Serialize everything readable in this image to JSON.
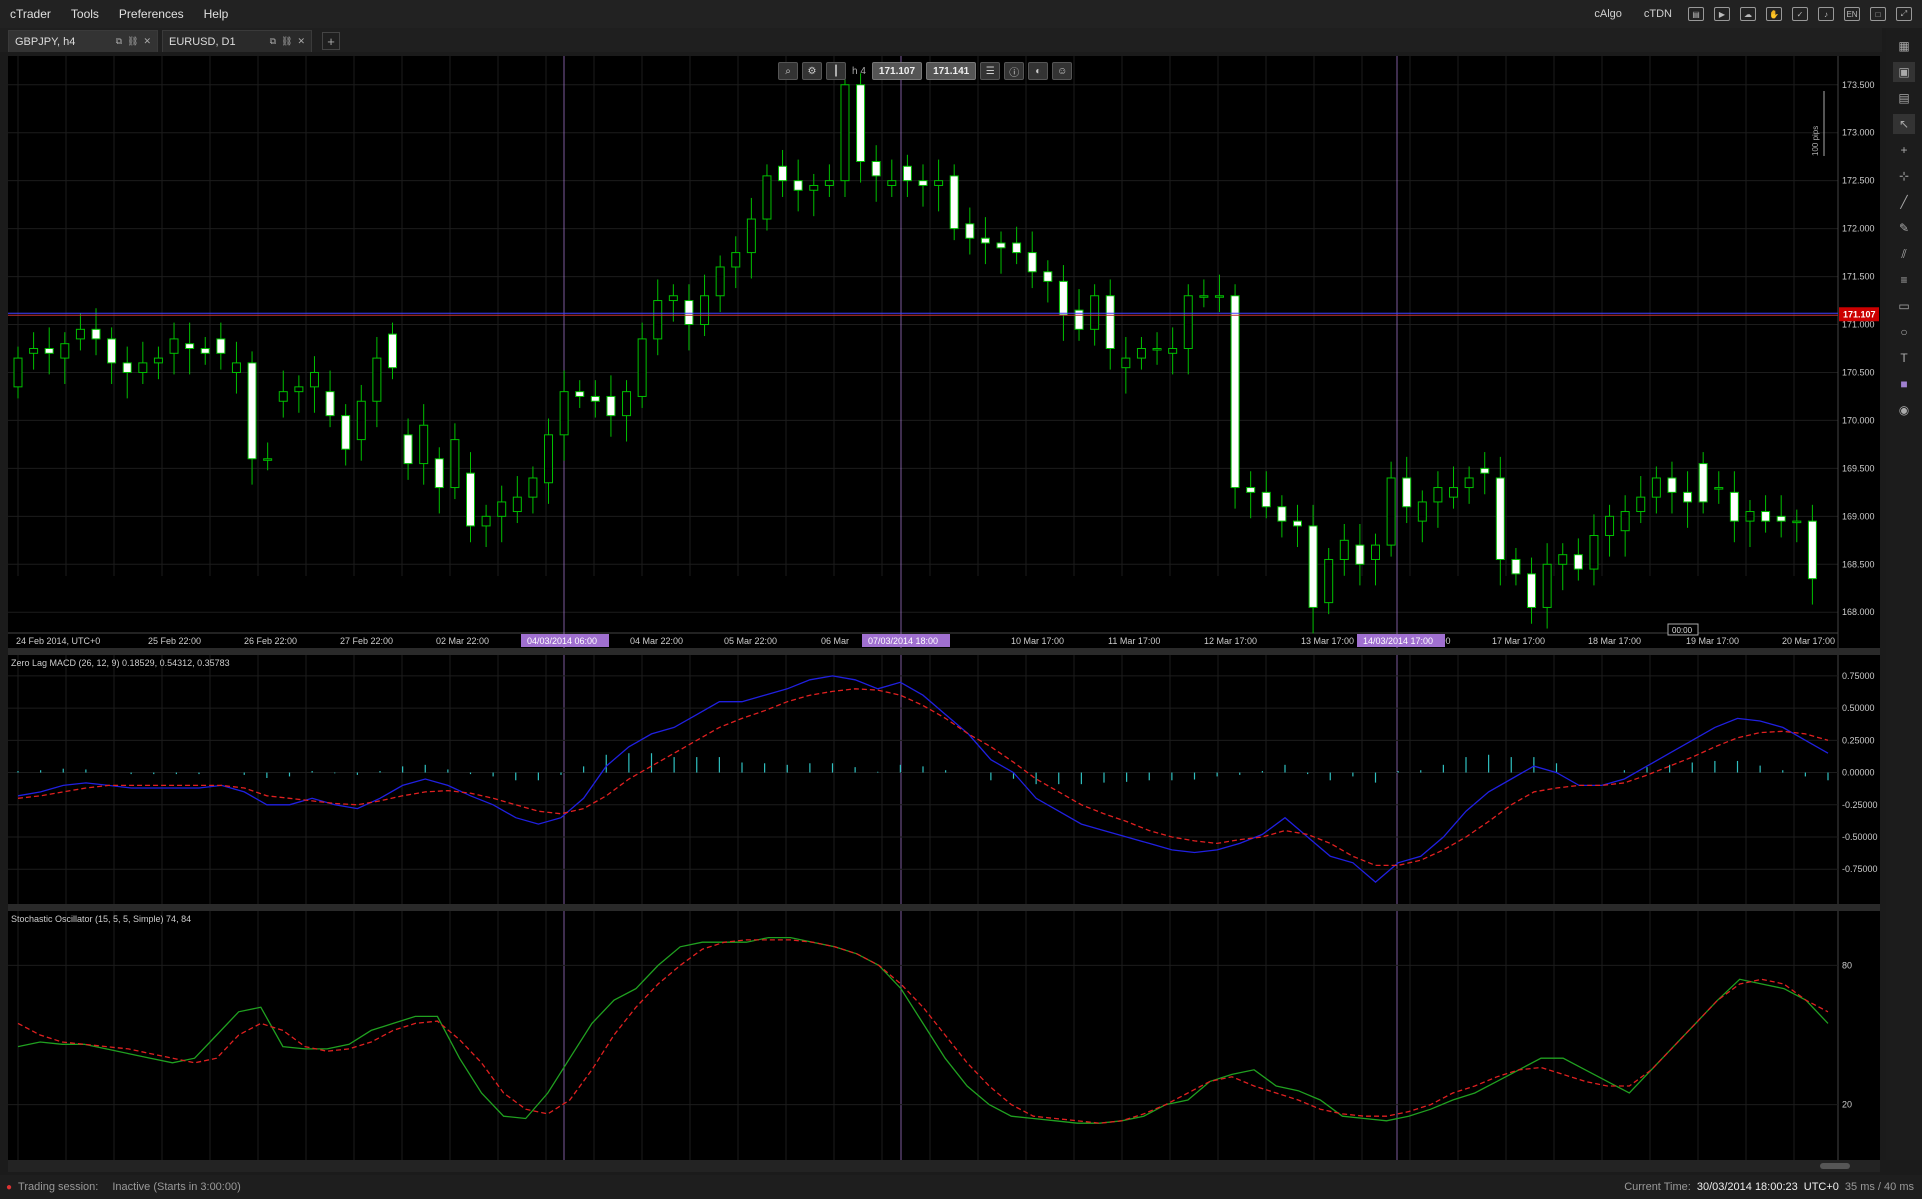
{
  "menu": [
    "cTrader",
    "Tools",
    "Preferences",
    "Help"
  ],
  "menubar_right": {
    "calgo": "cAlgo",
    "ctdn": "cTDN",
    "lang": "EN"
  },
  "tabs": [
    {
      "label": "GBPJPY, h4",
      "active": true
    },
    {
      "label": "EURUSD, D1",
      "active": false
    }
  ],
  "tab_add": "+",
  "toolbar": {
    "timeframe": "h 4",
    "bid": "171.107",
    "ask": "171.141"
  },
  "main_chart": {
    "symbol": "GBPJPY",
    "timeframe": "h4",
    "y_range": [
      167.7,
      173.8
    ],
    "y_ticks": [
      "173.500",
      "173.000",
      "172.500",
      "172.000",
      "171.500",
      "171.000",
      "170.500",
      "170.000",
      "169.500",
      "169.000",
      "168.500",
      "168.000"
    ],
    "current_price": "171.107",
    "pips_label": "100 pips",
    "x_labels": [
      "24 Feb 2014, UTC+0",
      "25 Feb 22:00",
      "26 Feb 22:00",
      "27 Feb 22:00",
      "02 Mar 22:00",
      "04 Mar 22:00",
      "05 Mar 22:00",
      "06 Mar",
      "17:00",
      "10 Mar 17:00",
      "11 Mar 17:00",
      "12 Mar 17:00",
      "13 Mar 17:00",
      ":00",
      "17 Mar 17:00",
      "18 Mar 17:00",
      "19 Mar 17:00",
      "20 Mar 17:00"
    ],
    "highlight_labels": [
      "04/03/2014 06:00",
      "07/03/2014 18:00",
      "14/03/2014 17:00"
    ],
    "candle_countdown": "00:00",
    "colors": {
      "bull": "#00c000",
      "bear_fill": "#ffffff",
      "price_line": "#4040ff",
      "current_price": "#cc0000",
      "marker": "#b080e0"
    }
  },
  "chart_data": [
    {
      "type": "candlestick",
      "title": "GBPJPY, h4",
      "ylim": [
        167.7,
        173.8
      ],
      "close": [
        170.65,
        170.75,
        170.7,
        170.8,
        170.95,
        170.85,
        170.6,
        170.5,
        170.6,
        170.65,
        170.85,
        170.75,
        170.7,
        170.7,
        170.6,
        169.6,
        169.6,
        170.3,
        170.35,
        170.5,
        170.05,
        169.7,
        170.2,
        170.65,
        170.55,
        169.55,
        169.95,
        169.3,
        169.8,
        168.9,
        169.0,
        169.15,
        169.2,
        169.4,
        169.85,
        170.3,
        170.25,
        170.2,
        170.05,
        170.3,
        170.85,
        171.25,
        171.3,
        171.0,
        171.3,
        171.6,
        171.75,
        172.1,
        172.55,
        172.5,
        172.4,
        172.45,
        172.5,
        173.5,
        172.7,
        172.55,
        172.5,
        172.5,
        172.45,
        172.5,
        172.0,
        171.9,
        171.85,
        171.8,
        171.75,
        171.55,
        171.45,
        171.1,
        170.95,
        171.3,
        170.75,
        170.65,
        170.75,
        170.75,
        170.75,
        171.3,
        171.3,
        171.3,
        169.3,
        169.25,
        169.1,
        168.95,
        168.9,
        168.05,
        168.55,
        168.75,
        168.5,
        168.7,
        169.4,
        169.1,
        169.15,
        169.3,
        169.3,
        169.4,
        169.45,
        168.55,
        168.4,
        168.05,
        168.5,
        168.6,
        168.45,
        168.8,
        169.0,
        169.05,
        169.2,
        169.4,
        169.25,
        169.15,
        169.15,
        169.3,
        168.95,
        169.05,
        168.95,
        168.95,
        168.95,
        168.35
      ],
      "open": [
        170.35,
        170.7,
        170.75,
        170.65,
        170.85,
        170.95,
        170.85,
        170.6,
        170.5,
        170.6,
        170.7,
        170.8,
        170.75,
        170.85,
        170.5,
        170.6,
        169.6,
        170.2,
        170.3,
        170.35,
        170.3,
        170.05,
        169.8,
        170.2,
        170.9,
        169.85,
        169.55,
        169.6,
        169.3,
        169.45,
        168.9,
        169.0,
        169.05,
        169.2,
        169.35,
        169.85,
        170.3,
        170.25,
        170.25,
        170.05,
        170.25,
        170.85,
        171.25,
        171.25,
        171.0,
        171.3,
        171.6,
        171.75,
        172.1,
        172.65,
        172.5,
        172.4,
        172.45,
        172.5,
        173.5,
        172.7,
        172.45,
        172.65,
        172.5,
        172.45,
        172.55,
        172.05,
        171.9,
        171.85,
        171.85,
        171.75,
        171.55,
        171.45,
        171.15,
        170.95,
        171.3,
        170.55,
        170.65,
        170.75,
        170.7,
        170.75,
        171.3,
        171.3,
        171.3,
        169.3,
        169.25,
        169.1,
        168.95,
        168.9,
        168.1,
        168.55,
        168.7,
        168.55,
        168.7,
        169.4,
        168.95,
        169.15,
        169.2,
        169.3,
        169.5,
        169.4,
        168.55,
        168.4,
        168.05,
        168.5,
        168.6,
        168.45,
        168.8,
        168.85,
        169.05,
        169.2,
        169.4,
        169.25,
        169.55,
        169.3,
        169.25,
        168.95,
        169.05,
        169.0,
        168.95,
        168.95
      ]
    },
    {
      "type": "line",
      "title": "Zero Lag MACD (26, 12, 9) 0.18529, 0.54312, 0.35783",
      "ylim": [
        -0.95,
        0.85
      ],
      "y_ticks": [
        "0.75000",
        "0.50000",
        "0.25000",
        "0.00000",
        "-0.25000",
        "-0.50000",
        "-0.75000"
      ],
      "series": [
        {
          "values": [
            -0.18,
            -0.15,
            -0.1,
            -0.08,
            -0.1,
            -0.12,
            -0.12,
            -0.12,
            -0.12,
            -0.1,
            -0.15,
            -0.25,
            -0.25,
            -0.2,
            -0.25,
            -0.28,
            -0.2,
            -0.1,
            -0.05,
            -0.1,
            -0.18,
            -0.25,
            -0.35,
            -0.4,
            -0.35,
            -0.2,
            0.05,
            0.2,
            0.3,
            0.35,
            0.45,
            0.55,
            0.55,
            0.6,
            0.65,
            0.72,
            0.75,
            0.72,
            0.65,
            0.7,
            0.6,
            0.45,
            0.3,
            0.1,
            0.0,
            -0.2,
            -0.3,
            -0.4,
            -0.45,
            -0.5,
            -0.55,
            -0.6,
            -0.62,
            -0.6,
            -0.55,
            -0.48,
            -0.35,
            -0.5,
            -0.65,
            -0.7,
            -0.85,
            -0.7,
            -0.65,
            -0.5,
            -0.3,
            -0.15,
            -0.05,
            0.05,
            0.0,
            -0.1,
            -0.1,
            -0.05,
            0.05,
            0.15,
            0.25,
            0.35,
            0.42,
            0.4,
            0.35,
            0.25,
            0.15
          ]
        },
        {
          "values": [
            -0.2,
            -0.18,
            -0.15,
            -0.12,
            -0.1,
            -0.1,
            -0.1,
            -0.1,
            -0.1,
            -0.1,
            -0.12,
            -0.18,
            -0.2,
            -0.22,
            -0.24,
            -0.25,
            -0.22,
            -0.18,
            -0.15,
            -0.14,
            -0.16,
            -0.2,
            -0.25,
            -0.3,
            -0.32,
            -0.28,
            -0.18,
            -0.05,
            0.05,
            0.15,
            0.25,
            0.35,
            0.42,
            0.48,
            0.55,
            0.6,
            0.63,
            0.65,
            0.64,
            0.6,
            0.52,
            0.42,
            0.3,
            0.2,
            0.08,
            -0.05,
            -0.15,
            -0.25,
            -0.32,
            -0.38,
            -0.45,
            -0.5,
            -0.53,
            -0.55,
            -0.52,
            -0.5,
            -0.45,
            -0.48,
            -0.55,
            -0.65,
            -0.72,
            -0.72,
            -0.68,
            -0.6,
            -0.5,
            -0.38,
            -0.25,
            -0.15,
            -0.12,
            -0.1,
            -0.1,
            -0.08,
            -0.02,
            0.05,
            0.12,
            0.2,
            0.27,
            0.31,
            0.32,
            0.3,
            0.25
          ]
        }
      ]
    },
    {
      "type": "line",
      "title": "Stochastic Oscillator (15, 5, 5, Simple) 74, 84",
      "ylim": [
        0,
        100
      ],
      "y_ticks": [
        "80",
        "20"
      ],
      "series": [
        {
          "values": [
            45,
            47,
            46,
            46,
            44,
            42,
            40,
            38,
            40,
            50,
            60,
            62,
            45,
            44,
            44,
            46,
            52,
            55,
            58,
            58,
            40,
            25,
            15,
            14,
            25,
            40,
            55,
            65,
            70,
            80,
            88,
            90,
            90,
            90,
            92,
            92,
            90,
            88,
            85,
            80,
            70,
            55,
            40,
            28,
            20,
            15,
            14,
            13,
            12,
            12,
            13,
            15,
            20,
            22,
            30,
            33,
            35,
            28,
            26,
            22,
            15,
            14,
            13,
            15,
            18,
            22,
            25,
            30,
            35,
            40,
            40,
            35,
            30,
            25,
            35,
            45,
            55,
            65,
            74,
            72,
            70,
            65,
            55
          ]
        },
        {
          "values": [
            55,
            50,
            47,
            46,
            45,
            44,
            42,
            40,
            38,
            40,
            50,
            55,
            52,
            45,
            43,
            44,
            47,
            52,
            55,
            56,
            48,
            38,
            25,
            18,
            16,
            22,
            35,
            50,
            62,
            72,
            80,
            87,
            90,
            91,
            91,
            91,
            90,
            88,
            85,
            80,
            72,
            62,
            50,
            38,
            28,
            20,
            15,
            14,
            13,
            12,
            13,
            16,
            20,
            25,
            30,
            32,
            28,
            25,
            22,
            18,
            16,
            15,
            15,
            17,
            20,
            25,
            28,
            32,
            35,
            36,
            33,
            30,
            28,
            28,
            35,
            45,
            55,
            65,
            72,
            74,
            72,
            65,
            60
          ]
        }
      ]
    }
  ],
  "statusbar": {
    "session_label": "Trading session:",
    "session_value": "Inactive (Starts in 3:00:00)",
    "time_label": "Current Time:",
    "time_value": "30/03/2014 18:00:23",
    "timezone": "UTC+0",
    "latency": "35 ms / 40 ms"
  }
}
